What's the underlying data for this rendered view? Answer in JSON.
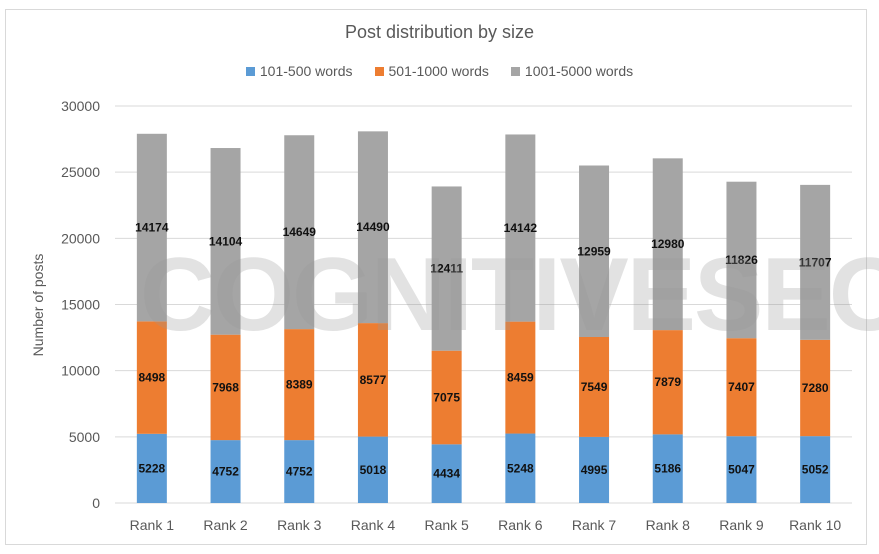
{
  "chart_data": {
    "type": "bar",
    "stacked": true,
    "title": "Post distribution by size",
    "xlabel": "",
    "ylabel": "Number of posts",
    "ylim": [
      0,
      30000
    ],
    "yticks": [
      0,
      5000,
      10000,
      15000,
      20000,
      25000,
      30000
    ],
    "grid": true,
    "legend_position": "top",
    "categories": [
      "Rank 1",
      "Rank 2",
      "Rank 3",
      "Rank 4",
      "Rank 5",
      "Rank 6",
      "Rank 7",
      "Rank 8",
      "Rank 9",
      "Rank 10"
    ],
    "series": [
      {
        "name": "101-500 words",
        "color": "#5b9bd5",
        "values": [
          5228,
          4752,
          4752,
          5018,
          4434,
          5248,
          4995,
          5186,
          5047,
          5052
        ]
      },
      {
        "name": "501-1000 words",
        "color": "#ed7d31",
        "values": [
          8498,
          7968,
          8389,
          8577,
          7075,
          8459,
          7549,
          7879,
          7407,
          7280
        ]
      },
      {
        "name": "1001-5000 words",
        "color": "#a5a5a5",
        "values": [
          14174,
          14104,
          14649,
          14490,
          12411,
          14142,
          12959,
          12980,
          11826,
          11707
        ]
      }
    ],
    "data_labels": true,
    "watermark": "COGNITIVESEO"
  }
}
